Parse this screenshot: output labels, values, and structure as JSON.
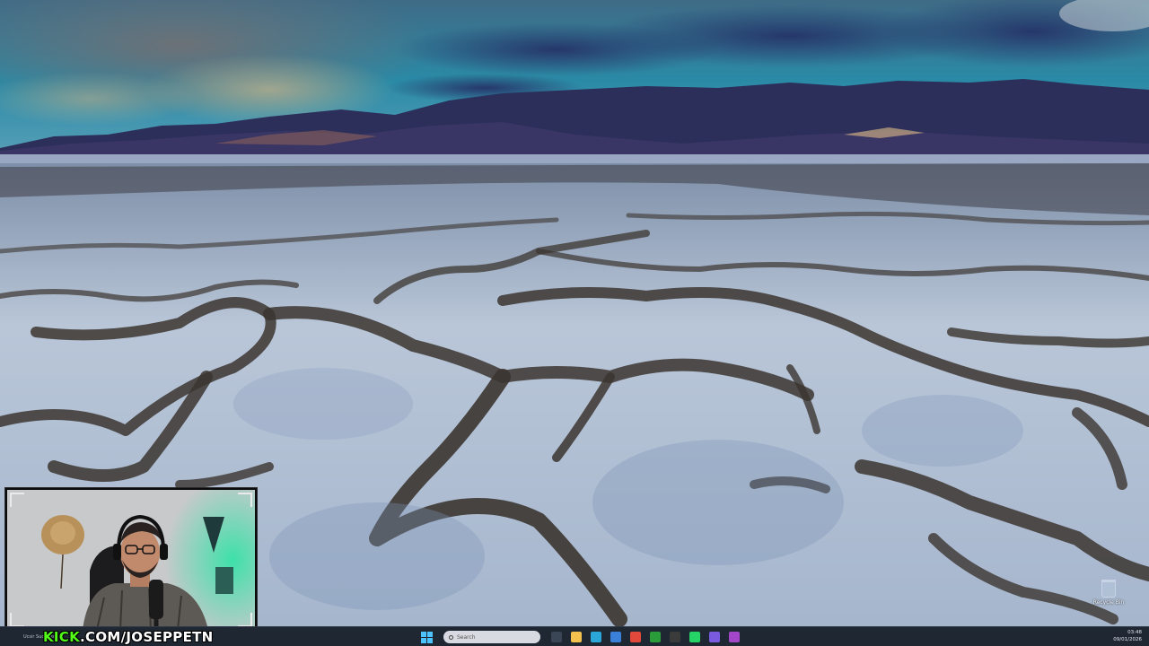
{
  "desktop": {
    "wallpaper_description": "",
    "icons": [
      {
        "label": "Recycle Bin",
        "icon": "recycle-bin-icon"
      }
    ]
  },
  "stream_overlay": {
    "channel_prefix": "KICK",
    "channel_suffix": ".COM/JOSEPPETN",
    "accent_color": "#53fc18"
  },
  "taskbar": {
    "left_text": "Ucsir Sucecus",
    "search_placeholder": "Search",
    "apps": [
      {
        "name": "task-view",
        "icon": "task-view-icon",
        "color": "#3a4556"
      },
      {
        "name": "file-explorer",
        "icon": "folder-icon",
        "color": "#f2c14e"
      },
      {
        "name": "edge",
        "icon": "edge-icon",
        "color": "#2aa7d8"
      },
      {
        "name": "store",
        "icon": "store-icon",
        "color": "#3a80d9"
      },
      {
        "name": "chrome",
        "icon": "chrome-icon",
        "color": "#e2493b"
      },
      {
        "name": "xbox",
        "icon": "xbox-icon",
        "color": "#2a9d3a"
      },
      {
        "name": "obs",
        "icon": "obs-icon",
        "color": "#3b3b3b"
      },
      {
        "name": "whatsapp",
        "icon": "whatsapp-icon",
        "color": "#25d366"
      },
      {
        "name": "app-purple",
        "icon": "app-icon",
        "color": "#7a5be0"
      },
      {
        "name": "app-violet",
        "icon": "app-icon",
        "color": "#a347c8"
      }
    ],
    "time": "03:48",
    "date": "09/01/2026"
  }
}
